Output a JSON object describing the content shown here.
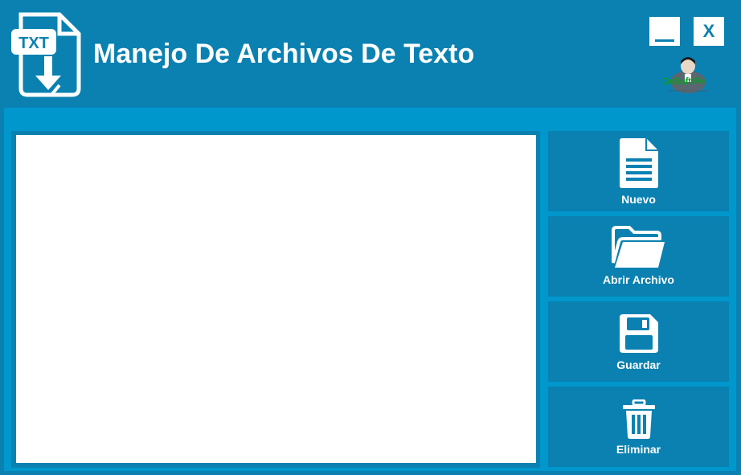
{
  "app": {
    "title": "Manejo De Archivos De Texto",
    "icon_label": "TXT",
    "logo_text": "DeSoft-Pe",
    "logo_subtext": "Aprende Mas con Nosotros"
  },
  "window_controls": {
    "minimize_label": "",
    "close_label": "X"
  },
  "editor": {
    "value": "",
    "placeholder": ""
  },
  "actions": [
    {
      "label": "Nuevo",
      "icon": "new-file-icon"
    },
    {
      "label": "Abrir Archivo",
      "icon": "folder-open-icon"
    },
    {
      "label": "Guardar",
      "icon": "save-icon"
    },
    {
      "label": "Eliminar",
      "icon": "trash-icon"
    }
  ],
  "colors": {
    "header_bg": "#0a81b1",
    "panel_bg": "#0097cc",
    "button_bg": "#0a81b1",
    "text": "#ffffff",
    "logo_green": "#0d9b2a"
  }
}
